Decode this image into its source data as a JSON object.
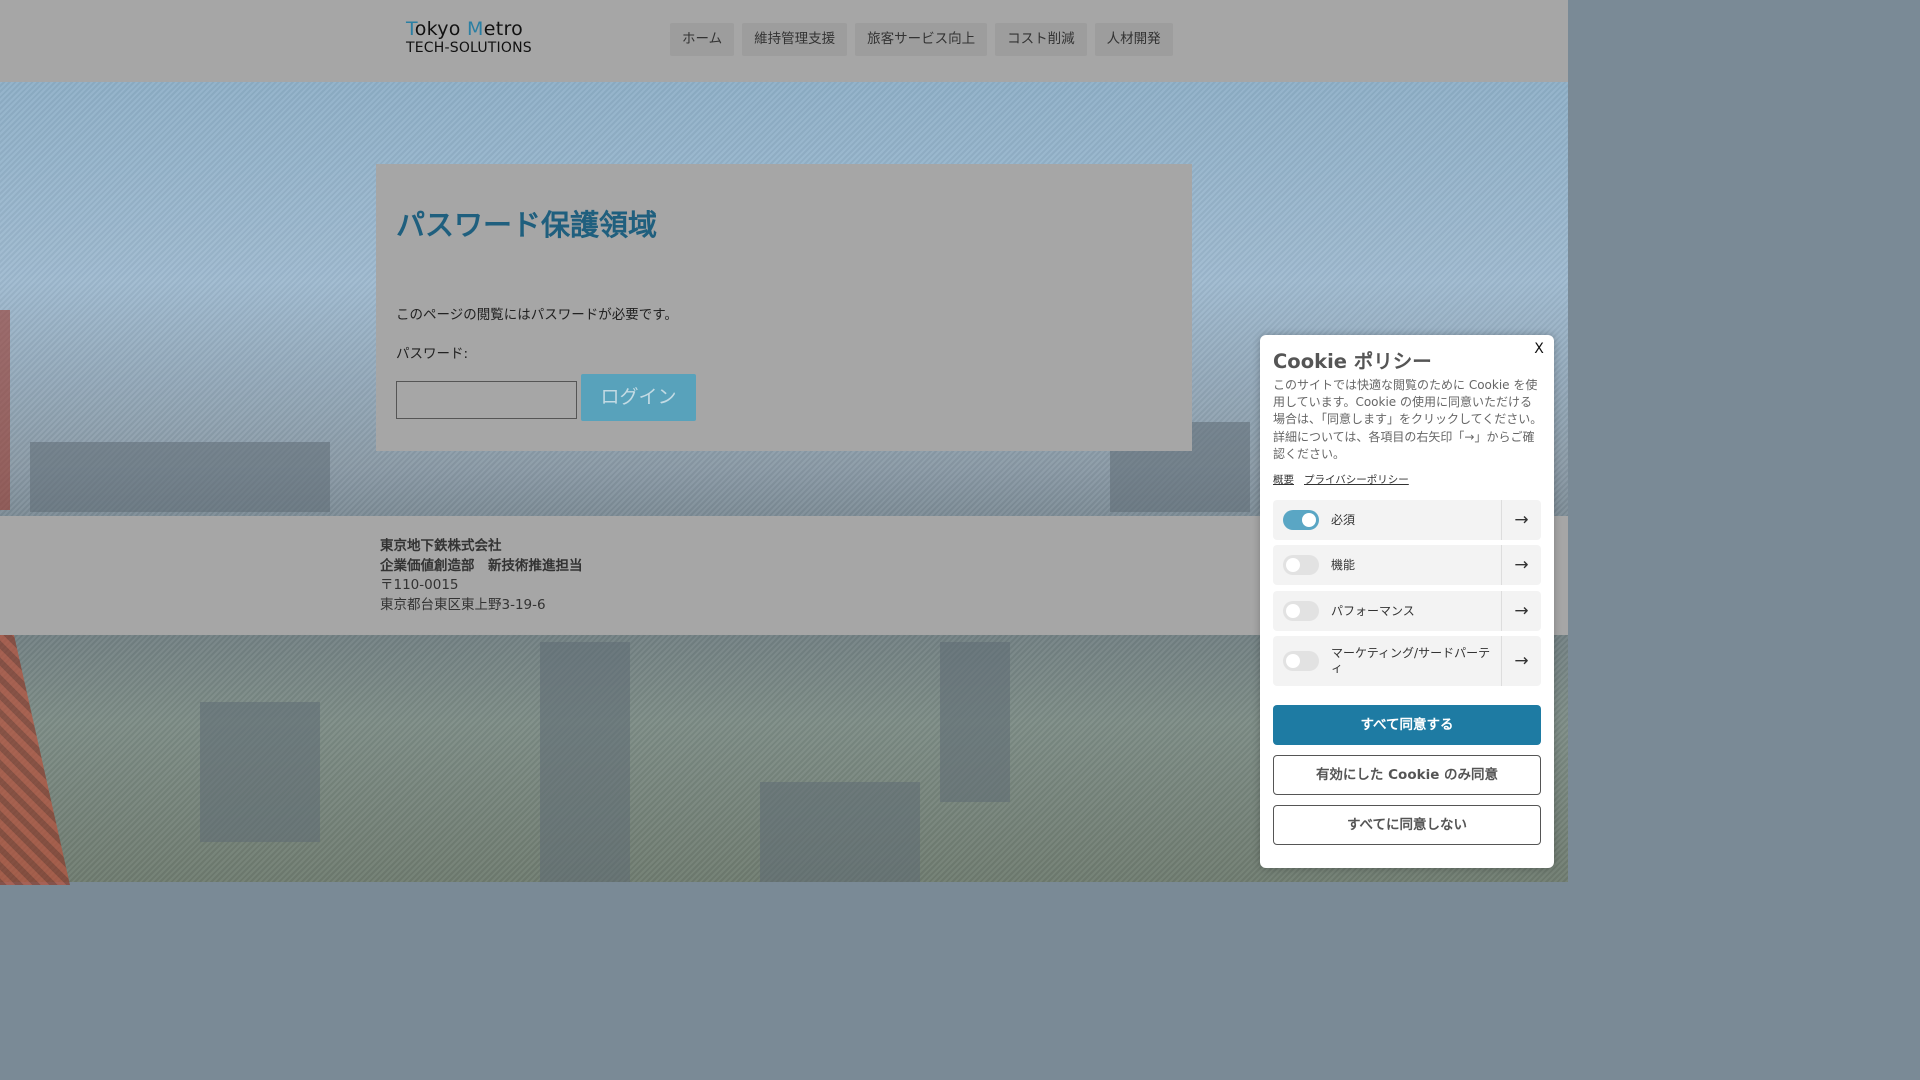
{
  "header": {
    "logo": {
      "line1_t": "T",
      "line1_rest1": "okyo ",
      "line1_m": "M",
      "line1_rest2": "etro",
      "line2": "TECH-SOLUTIONS"
    },
    "nav": [
      "ホーム",
      "維持管理支援",
      "旅客サービス向上",
      "コスト削減",
      "人材開発"
    ]
  },
  "main": {
    "title": "パスワード保護領域",
    "description": "このページの閲覧にはパスワードが必要です。",
    "password_label": "パスワード:",
    "password_value": "",
    "login_label": "ログイン"
  },
  "footer": {
    "company": "東京地下鉄株式会社",
    "department": "企業価値創造部　新技術推進担当",
    "postal": "〒110-0015",
    "address": "東京都台東区東上野3-19-6"
  },
  "cookie": {
    "close_label": "X",
    "title": "Cookie ポリシー",
    "body": "このサイトでは快適な閲覧のために Cookie を使用しています。Cookie の使用に同意いただける場合は、「同意します」をクリックしてください。詳細については、各項目の右矢印「→」からご確認ください。",
    "links": [
      "概要",
      "プライバシーポリシー"
    ],
    "categories": [
      {
        "label": "必須",
        "enabled": true
      },
      {
        "label": "機能",
        "enabled": false
      },
      {
        "label": "パフォーマンス",
        "enabled": false
      },
      {
        "label": "マーケティング/サードパーティ",
        "enabled": false
      }
    ],
    "arrow_icon": "→",
    "accept_all": "すべて同意する",
    "accept_selected": "有効にした Cookie のみ同意",
    "reject_all": "すべてに同意しない"
  },
  "colors": {
    "accent": "#1e7ba3",
    "title": "#1f5f7e",
    "login_button": "#58a2bb"
  }
}
